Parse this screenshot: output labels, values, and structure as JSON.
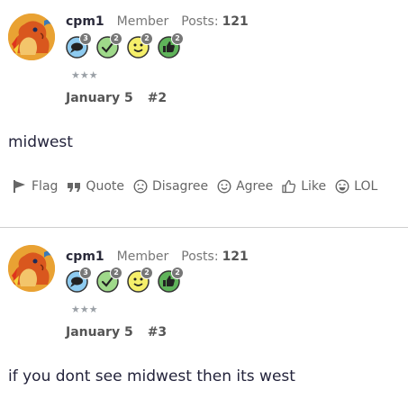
{
  "posts": [
    {
      "username": "cpm1",
      "role": "Member",
      "posts_label": "Posts:",
      "posts_count": "121",
      "badges": [
        {
          "icon": "speech-bubble-icon",
          "count": "3"
        },
        {
          "icon": "check-icon",
          "count": "2"
        },
        {
          "icon": "smiley-icon",
          "count": "2"
        },
        {
          "icon": "thumbs-up-icon",
          "count": "2"
        }
      ],
      "stars": "★★★",
      "date": "January 5",
      "post_number": "#2",
      "content": "midwest"
    },
    {
      "username": "cpm1",
      "role": "Member",
      "posts_label": "Posts:",
      "posts_count": "121",
      "badges": [
        {
          "icon": "speech-bubble-icon",
          "count": "3"
        },
        {
          "icon": "check-icon",
          "count": "2"
        },
        {
          "icon": "smiley-icon",
          "count": "2"
        },
        {
          "icon": "thumbs-up-icon",
          "count": "2"
        }
      ],
      "stars": "★★★",
      "date": "January 5",
      "post_number": "#3",
      "content": "if you dont see midwest then its west"
    }
  ],
  "actions": {
    "flag": "Flag",
    "quote": "Quote",
    "disagree": "Disagree",
    "agree": "Agree",
    "like": "Like",
    "lol": "LOL"
  },
  "colors": {
    "bubble_badge": "#8ecbf0",
    "check_badge": "#9fd98a",
    "smiley_badge": "#f5ef6a",
    "thumb_badge": "#5fb35a",
    "avatar_bg": "#e9a233"
  }
}
